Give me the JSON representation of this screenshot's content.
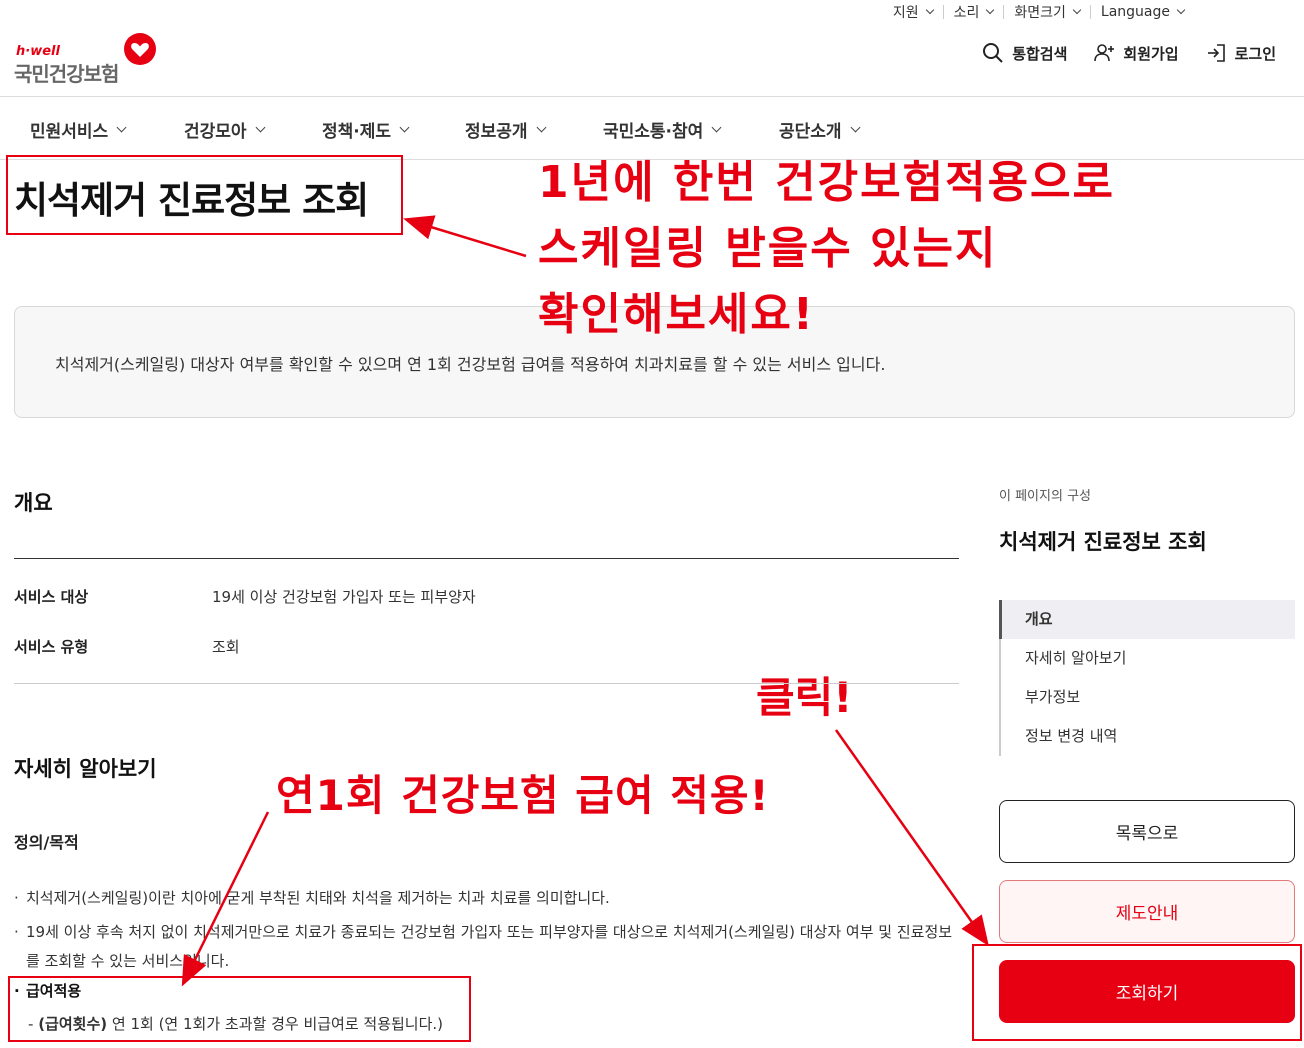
{
  "utility": {
    "support": "지원",
    "sound": "소리",
    "screen_size": "화면크기",
    "language": "Language"
  },
  "logo": {
    "brand": "h·well",
    "name": "국민건강보험"
  },
  "header_actions": {
    "search": "통합검색",
    "signup": "회원가입",
    "login": "로그인"
  },
  "gnb": [
    "민원서비스",
    "건강모아",
    "정책·제도",
    "정보공개",
    "국민소통·참여",
    "공단소개"
  ],
  "page": {
    "title": "치석제거 진료정보 조회",
    "intro": "치석제거(스케일링) 대상자 여부를 확인할 수 있으며 연 1회 건강보험 급여를 적용하여 치과치료를 할 수 있는 서비스 입니다."
  },
  "overview": {
    "heading": "개요",
    "rows": [
      {
        "label": "서비스 대상",
        "value": "19세 이상 건강보험 가입자 또는 피부양자"
      },
      {
        "label": "서비스 유형",
        "value": "조회"
      }
    ]
  },
  "details": {
    "heading": "자세히 알아보기",
    "subheading": "정의/목적",
    "bullets": [
      "치석제거(스케일링)이란 치아에 굳게 부착된 치태와 치석을 제거하는 치과 치료를 의미합니다.",
      "19세 이상 후속 처지 없이 치석제거만으로 치료가 종료되는 건강보험 가입자 또는 피부양자를 대상으로 치석제거(스케일링) 대상자 여부 및 진료정보를 조회할 수 있는 서비스입니다."
    ],
    "benefit_title": "급여적용",
    "benefit_label": "(급여횟수)",
    "benefit_text": "연 1회 (연 1회가 초과할 경우 비급여로 적용됩니다.)"
  },
  "aside": {
    "caption": "이 페이지의 구성",
    "title": "치석제거 진료정보 조회",
    "toc": [
      "개요",
      "자세히 알아보기",
      "부가정보",
      "정보 변경 내역"
    ],
    "btn_list": "목록으로",
    "btn_guide": "제도안내",
    "btn_query": "조회하기"
  },
  "annotations": {
    "line1": "1년에 한번 건강보험적용으로",
    "line2": "스케일링 받을수 있는지",
    "line3": "확인해보세요!",
    "click": "클릭!",
    "benefit": "연1회 건강보험 급여 적용!"
  },
  "colors": {
    "accent": "#e60012",
    "guide_bg": "#fff5f5"
  }
}
